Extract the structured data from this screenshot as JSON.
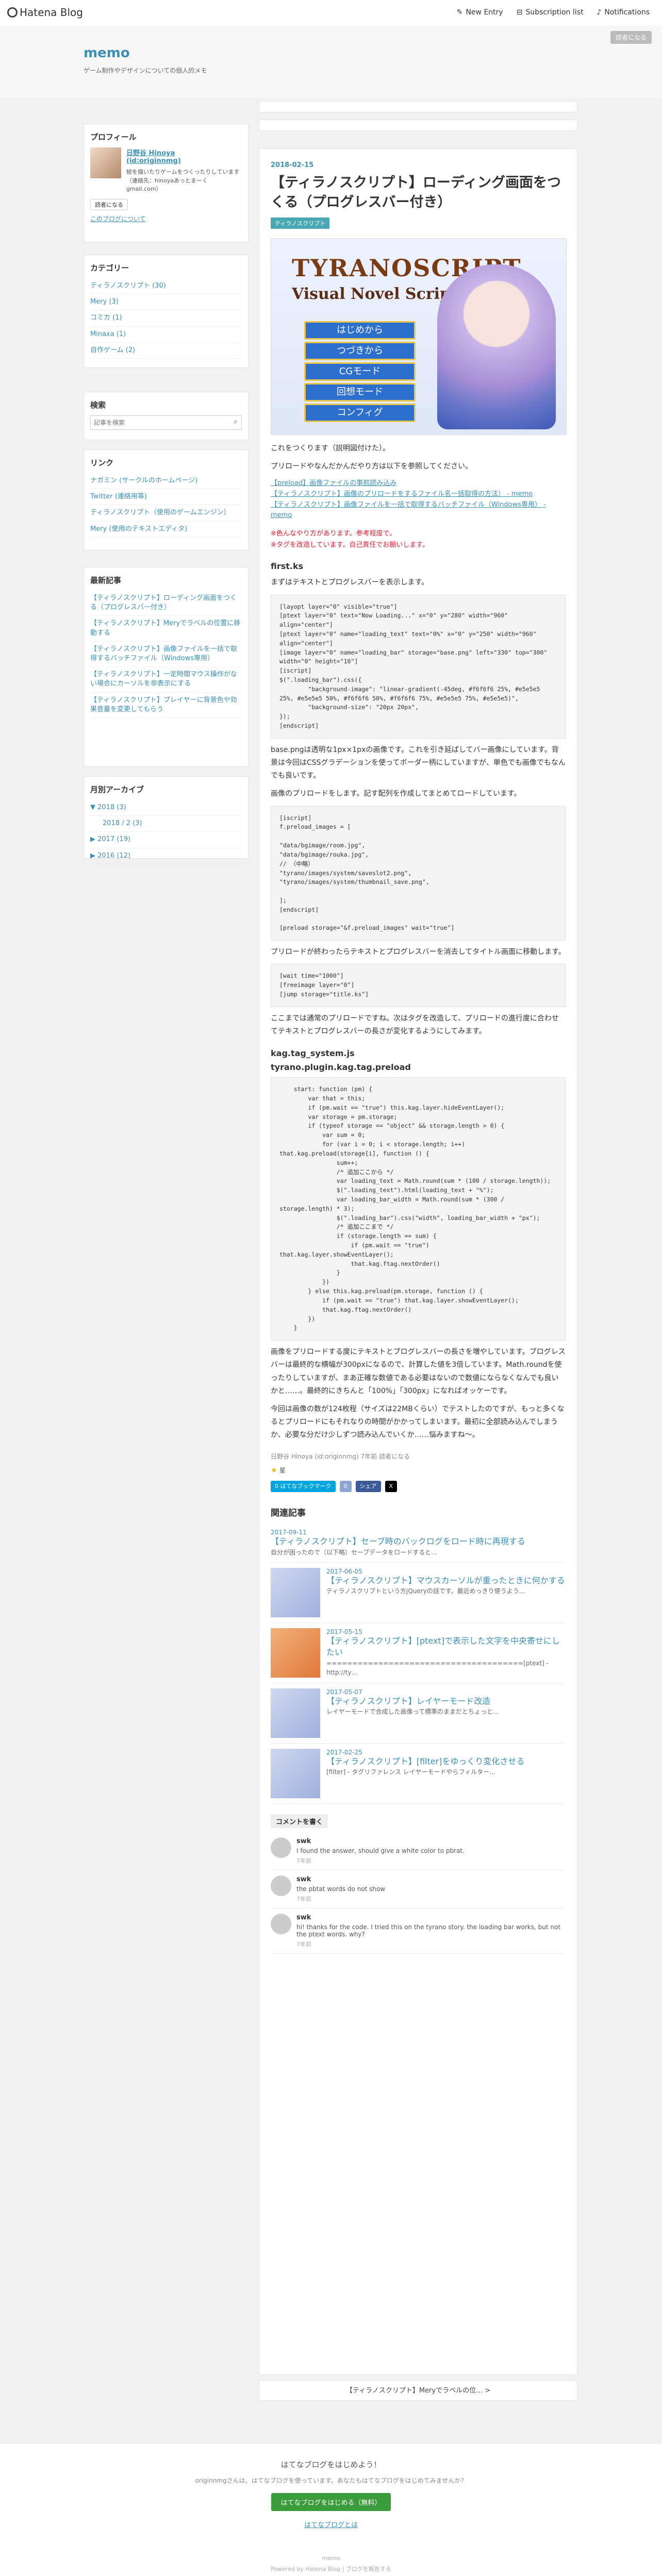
{
  "topbar": {
    "brand": "Hatena Blog",
    "new_entry": "New Entry",
    "subscription": "Subscription list",
    "notifications": "Notifications"
  },
  "header": {
    "title": "memo",
    "description": "ゲーム制作やデザインについての個人的メモ",
    "reader_btn": "読者になる"
  },
  "profile": {
    "heading": "プロフィール",
    "name": "日野谷 Hinoya",
    "id": "(id:originnmg)",
    "bio": "絵を描いたりゲームをつくったりしています（連絡先：hinoyaあっとまーく gmail.com）",
    "reader_btn": "読者になる",
    "about_link": "このブログについて"
  },
  "categories": {
    "heading": "カテゴリー",
    "items": [
      "ティラノスクリプト (30)",
      "Mery (3)",
      "コミカ (1)",
      "Minaxa (1)",
      "自作ゲーム (2)"
    ]
  },
  "search": {
    "heading": "検索",
    "placeholder": "記事を検索"
  },
  "links": {
    "heading": "リンク",
    "items": [
      "ナガミン (サークルのホームページ)",
      "Twitter (連絡用等)",
      "ティラノスクリプト（使用のゲームエンジン）",
      "Mery (使用のテキストエディタ)"
    ]
  },
  "recent": {
    "heading": "最新記事",
    "items": [
      "【ティラノスクリプト】ローディング画面をつくる（プログレスバー付き）",
      "【ティラノスクリプト】Meryでラベルの位置に移動する",
      "【ティラノスクリプト】画像ファイルを一括で取得するバッチファイル（Windows専用）",
      "【ティラノスクリプト】一定時間マウス操作がない場合にカーソルを非表示にする",
      "【ティラノスクリプト】プレイヤーに背景色や効果音量を変更してもらう"
    ]
  },
  "archive": {
    "heading": "月別アーカイブ",
    "items": [
      "▼ 2018 (3)",
      "2018 / 2 (3)",
      "▶ 2017 (19)",
      "▶ 2016 (12)"
    ]
  },
  "article": {
    "date": "2018-02-15",
    "title": "【ティラノスクリプト】ローディング画面をつくる（プログレスバー付き）",
    "tag": "ティラノスクリプト",
    "hero": {
      "logo_line1": "TYRANOSCRIPT",
      "logo_line2": "Visual Novel Scripting",
      "buttons": [
        "はじめから",
        "つづきから",
        "CGモード",
        "回想モード",
        "コンフィグ"
      ]
    },
    "intro1": "これをつくります（説明図付けた）。",
    "intro2": "プリロードやなんだかんだやり方は以下を参照してください。",
    "links": [
      "【preload】画像ファイルの事前読み込み",
      "【ティラノスクリプト】画像のプリロードをするファイル名一括取得の方法） - memo",
      "【ティラノスクリプト】画像ファイルを一括で取得するバッチファイル（Windows専用） - memo"
    ],
    "warn1": "※色んなやり方があります。参考程度で。",
    "warn2": "※タグを改造しています。自己責任でお願いします。",
    "h_first": "first.ks",
    "p_first": "まずはテキストとプログレスバーを表示します。",
    "code1": "[layopt layer=\"0\" visible=\"true\"]\n[ptext layer=\"0\" text=\"Now Loading...\" x=\"0\" y=\"280\" width=\"960\" align=\"center\"]\n[ptext layer=\"0\" name=\"loading_text\" text=\"0%\" x=\"0\" y=\"250\" width=\"960\" align=\"center\"]\n[image layer=\"0\" name=\"loading_bar\" storage=\"base.png\" left=\"330\" top=\"300\" width=\"0\" height=\"10\"]\n[iscript]\n$(\".loading_bar\").css({\n        \"background-image\": \"linear-gradient(-45deg, #f6f6f6 25%, #e5e5e5 25%, #e5e5e5 50%, #f6f6f6 50%, #f6f6f6 75%, #e5e5e5 75%, #e5e5e5)\",\n        \"background-size\": \"20px 20px\",\n});\n[endscript]",
    "p_base": "base.pngは透明な1px×1pxの画像です。これを引き延ばしてバー画像にしています。背景は今回はCSSグラデーションを使ってボーダー柄にしていますが、単色でも画像でもなんでも良いです。",
    "p_preload": "画像のプリロードをします。記す配列を作成してまとめてロードしています。",
    "code2": "[iscript]\nf.preload_images = [\n\n\"data/bgimage/room.jpg\",\n\"data/bgimage/rouka.jpg\",\n// （中略）\n\"tyrano/images/system/saveslot2.png\",\n\"tyrano/images/system/thumbnail_save.png\",\n\n];\n[endscript]\n\n[preload storage=\"&f.preload_images\" wait=\"true\"]",
    "p_after": "プリロードが終わったらテキストとプログレスバーを消去してタイトル画面に移動します。",
    "code3": "[wait time=\"1000\"]\n[freeimage layer=\"0\"]\n[jump storage=\"title.ks\"]",
    "p_tag": "ここまでは通常のプリロードですね。次はタグを改造して、プリロードの進行度に合わせてテキストとプログレスバーの長さが変化するようにしてみます。",
    "h_tag": "kag.tag_system.js",
    "h_tag2": "tyrano.plugin.kag.tag.preload",
    "code4": "    start: function (pm) {\n        var that = this;\n        if (pm.wait == \"true\") this.kag.layer.hideEventLayer();\n        var storage = pm.storage;\n        if (typeof storage == \"object\" && storage.length > 0) {\n            var sum = 0;\n            for (var i = 0; i < storage.length; i++)\nthat.kag.preload(storage[i], function () {\n                sum++;\n                /* 追加ここから */\n                var loading_text = Math.round(sum * (100 / storage.length));\n                $(\".loading_text\").html(loading_text + \"%\");\n                var loading_bar_width = Math.round(sum * (300 / storage.length) * 3);\n                $(\".loading_bar\").css(\"width\", loading_bar_width + \"px\");\n                /* 追加ここまで */\n                if (storage.length == sum) {\n                    if (pm.wait == \"true\")\nthat.kag.layer.showEventLayer();\n                    that.kag.ftag.nextOrder()\n                }\n            })\n        } else this.kag.preload(pm.storage, function () {\n            if (pm.wait == \"true\") that.kag.layer.showEventLayer();\n            that.kag.ftag.nextOrder()\n        })\n    }",
    "p_end1": "画像をプリロードする度にテキストとプログレスバーの長さを増やしています。プログレスバーは最終的な横幅が300pxになるので、計算した値を3倍しています。Math.roundを使ったりしていますが、まあ正確な数値である必要はないので数値にならなくなんでも良いかと……。最終的にきちんと「100%」「300px」になればオッケーです。",
    "p_end2": "今回は画像の数が124枚程（サイズは22MBくらい）でテストしたのですが、もっと多くなるとプリロードにもそれなりの時間がかかってしまいます。最初に全部読み込んでしまうか、必要な分だけ少しずつ読み込んでいくか……悩みますね～。",
    "meta": "日野谷 Hinoya (id:originnmg) 7年前  読者になる",
    "star_label": "星",
    "share": [
      "0 はてなブックマーク",
      "0",
      "シェア",
      "X"
    ]
  },
  "related": {
    "heading": "関連記事",
    "items": [
      {
        "date": "2017-09-11",
        "title": "【ティラノスクリプト】セーブ時のバックログをロード時に再現する",
        "desc": "自分が困ったので（以下略）セーブデータをロードすると…"
      },
      {
        "date": "2017-06-05",
        "title": "【ティラノスクリプト】マウスカーソルが重ったときに何かする",
        "desc": "ティラノスクリプトという方jQueryの話です。最近めっきり使うよう…"
      },
      {
        "date": "2017-05-15",
        "title": "【ティラノスクリプト】[ptext]で表示した文字を中央寄せにしたい",
        "desc": "======================================[ptext] - http://ty…"
      },
      {
        "date": "2017-05-07",
        "title": "【ティラノスクリプト】レイヤーモード改造",
        "desc": "レイヤーモードで合成した画像って標準のままだとちょっと…"
      },
      {
        "date": "2017-02-25",
        "title": "【ティラノスクリプト】[filter]をゆっくり変化させる",
        "desc": "[filter] - タグリファレンス レイヤーモードやらフィルター…"
      }
    ]
  },
  "comments": {
    "heading": "コメントを書く",
    "items": [
      {
        "name": "swk",
        "body": "I found the answer, should give a white color to pbrat.",
        "ago": "7年前"
      },
      {
        "name": "swk",
        "body": "the pbtat words do not show",
        "ago": "7年前"
      },
      {
        "name": "swk",
        "body": "hi! thanks for the code. I tried this on the tyrano story. the loading bar works, but not the ptext words. why?",
        "ago": "7年前"
      }
    ]
  },
  "pager": {
    "next": "【ティラノスクリプト】Meryでラベルの位… >"
  },
  "footer": {
    "question": "はてなブログをはじめよう！",
    "sub": "originnmgさんは、はてなブログを使っています。あなたもはてなブログをはじめてみませんか？",
    "cta": "はてなブログをはじめる（無料）",
    "about": "はてなブログとは",
    "powered": "memo",
    "powered2": "Powered by Hatena Blog | ブログを報告する"
  },
  "colors": {
    "accent": "#3a8fb7",
    "tag": "#4aa8b5",
    "warn": "#dd2233"
  }
}
